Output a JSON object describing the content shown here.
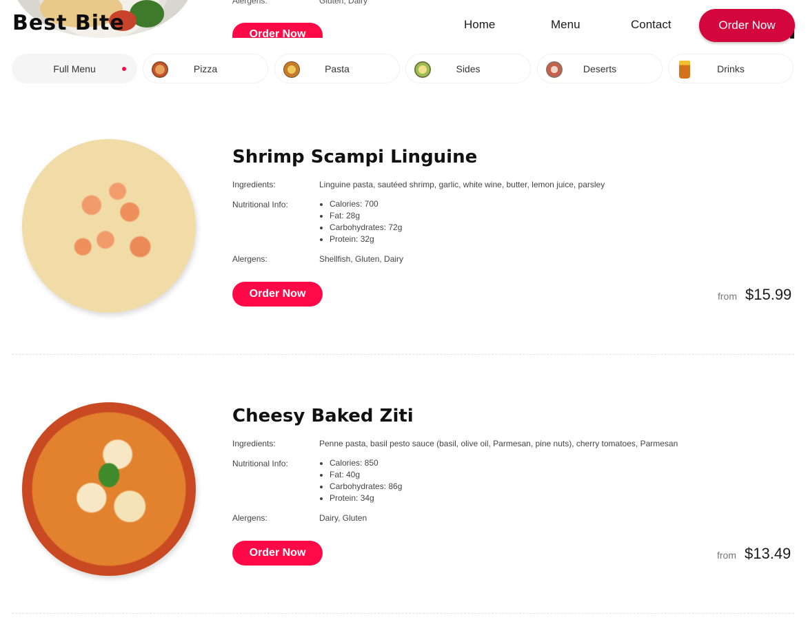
{
  "header": {
    "logo": "Best Bite",
    "nav": [
      "Home",
      "Menu",
      "Contact"
    ],
    "cta": "Order Now"
  },
  "partial_item": {
    "allergens_label": "Alergens:",
    "allergens": "Gluten, Dairy",
    "order_label": "Order Now"
  },
  "categories": [
    {
      "label": "Full Menu",
      "icon": "active-dot-icon",
      "active": true
    },
    {
      "label": "Pizza",
      "icon": "pizza-icon"
    },
    {
      "label": "Pasta",
      "icon": "pasta-icon"
    },
    {
      "label": "Sides",
      "icon": "sides-icon"
    },
    {
      "label": "Deserts",
      "icon": "deserts-icon"
    },
    {
      "label": "Drinks",
      "icon": "drinks-icon"
    }
  ],
  "menu": {
    "labels": {
      "ingredients": "Ingredients:",
      "nutrition": "Nutritional Info:",
      "allergens": "Alergens:",
      "order": "Order Now",
      "from": "from"
    },
    "items": [
      {
        "name": "Shrimp Scampi Linguine",
        "ingredients": "Linguine pasta, sautéed shrimp, garlic, white wine, butter, lemon juice, parsley",
        "nutrition": [
          "Calories: 700",
          "Fat: 28g",
          "Carbohydrates: 72g",
          "Protein: 32g"
        ],
        "allergens": "Shellfish, Gluten, Dairy",
        "price": "$15.99"
      },
      {
        "name": "Cheesy Baked Ziti",
        "ingredients": "Penne pasta, basil pesto sauce (basil, olive oil, Parmesan, pine nuts), cherry tomatoes, Parmesan",
        "nutrition": [
          "Calories: 850",
          "Fat: 40g",
          "Carbohydrates: 86g",
          "Protein: 34g"
        ],
        "allergens": "Dairy, Gluten",
        "price": "$13.49"
      }
    ]
  },
  "colors": {
    "accent": "#ff0a47",
    "nav_cta": "#d3063d"
  }
}
